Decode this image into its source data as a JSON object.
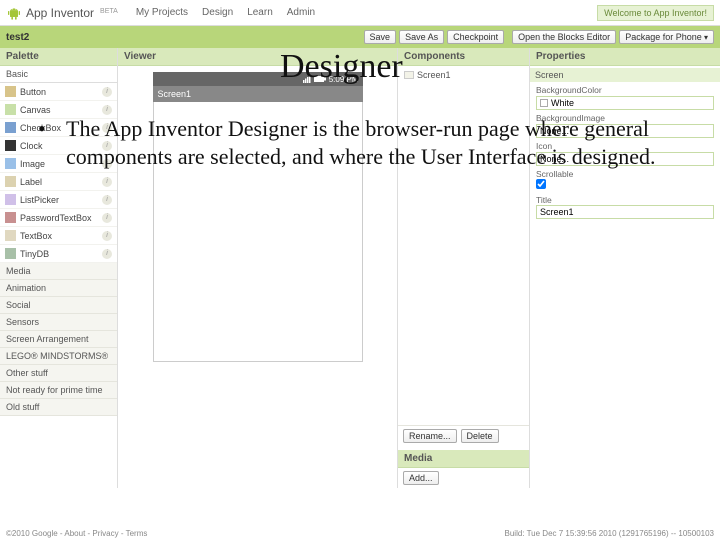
{
  "topbar": {
    "brand": "App Inventor",
    "beta": "BETA",
    "nav": [
      "My Projects",
      "Design",
      "Learn",
      "Admin"
    ],
    "welcome": "Welcome to App Inventor!"
  },
  "projectbar": {
    "name": "test2",
    "left_buttons": [
      "Save",
      "Save As",
      "Checkpoint"
    ],
    "right_buttons": [
      "Open the Blocks Editor",
      "Package for Phone"
    ]
  },
  "columns": {
    "palette": {
      "header": "Palette",
      "open_category": "Basic",
      "items": [
        "Button",
        "Canvas",
        "CheckBox",
        "Clock",
        "Image",
        "Label",
        "ListPicker",
        "PasswordTextBox",
        "TextBox",
        "TinyDB"
      ],
      "categories": [
        "Media",
        "Animation",
        "Social",
        "Sensors",
        "Screen Arrangement",
        "LEGO® MINDSTORMS®",
        "Other stuff",
        "Not ready for prime time",
        "Old stuff"
      ]
    },
    "viewer": {
      "header": "Viewer",
      "phone_time": "5:09 PM",
      "screen_title": "Screen1"
    },
    "components": {
      "header": "Components",
      "root": "Screen1",
      "actions": [
        "Rename...",
        "Delete"
      ],
      "media_header": "Media",
      "media_add": "Add..."
    },
    "properties": {
      "header": "Properties",
      "subhead": "Screen",
      "bg_label": "BackgroundColor",
      "bg_value": "White",
      "bgimg_label": "BackgroundImage",
      "bgimg_value": "None...",
      "icon_label": "Icon",
      "icon_value": "None...",
      "scroll_label": "Scrollable",
      "title_label": "Title",
      "title_value": "Screen1"
    }
  },
  "footer": {
    "left": "©2010 Google - About - Privacy - Terms",
    "right": "Build: Tue Dec 7 15:39:56 2010 (1291765196) -- 10500103"
  },
  "overlay": {
    "title": "Designer",
    "body": "The App Inventor Designer is the browser-run page where general components are selected, and where the User Interface is designed."
  }
}
